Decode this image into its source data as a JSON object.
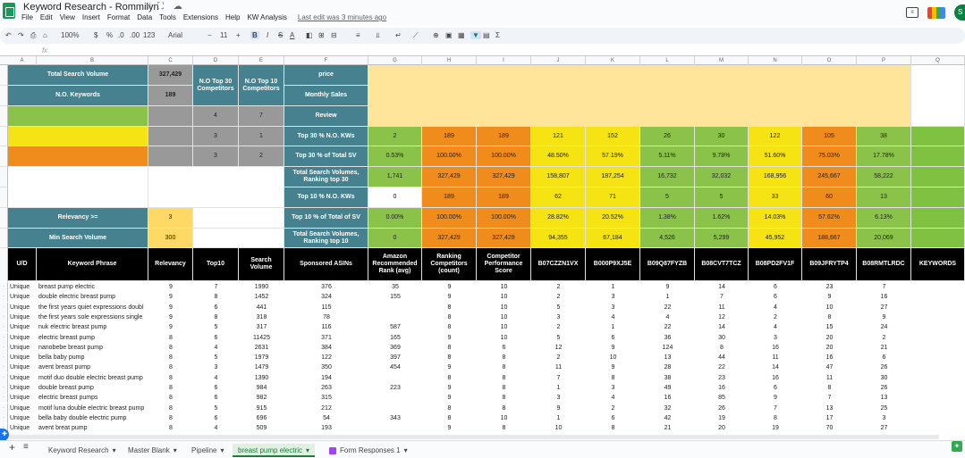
{
  "doc": {
    "title": "Keyword Research - Rommilyn",
    "star": "☆",
    "icons": "⛶ ☁",
    "last_edit": "Last edit was 3 minutes ago"
  },
  "menu": [
    "File",
    "Edit",
    "View",
    "Insert",
    "Format",
    "Data",
    "Tools",
    "Extensions",
    "Help",
    "KW Analysis"
  ],
  "toolbar": {
    "undo": "↶",
    "redo": "↷",
    "print": "⎙",
    "paint": "⌂",
    "zoom": "100%",
    "currency": "$",
    "percent": "%",
    "dec_down": ".0",
    "dec_up": ".00",
    "format": "123",
    "font": "Arial",
    "size": "11",
    "minus": "−",
    "plus": "+",
    "bold": "B",
    "italic": "I",
    "strike": "S",
    "textcolor": "A",
    "fill": "◧",
    "borders": "⊞",
    "merge": "⊟",
    "halign": "≡",
    "valign": "⫫",
    "wrap": "↵",
    "rotate": "⟋",
    "link": "⊕",
    "comment": "▣",
    "chart": "▦",
    "filter": "▼",
    "filterviews": "▤",
    "functions": "Σ"
  },
  "formula": {
    "fx": "fx"
  },
  "colors": {
    "teal": "#45818e",
    "gray": "#999999",
    "yellow": "#ffd966",
    "green": "#8bc34a",
    "bright_yellow": "#f5e313",
    "orange": "#f08c1c",
    "black": "#000000"
  },
  "cols": [
    "A",
    "B",
    "C",
    "D",
    "E",
    "F",
    "G",
    "H",
    "I",
    "J",
    "K",
    "L",
    "M",
    "N",
    "O",
    "P",
    "Q"
  ],
  "summary": {
    "tsv_label": "Total Search Volume",
    "tsv": "327,429",
    "nok_label": "N.O. Keywords",
    "nok": "189",
    "top30_comp": "N.O Top 30 Competitors",
    "top10_comp": "N.O Top 10 Competitors",
    "price": "price",
    "monthly": "Monthly Sales",
    "review": "Review",
    "r3d": "4",
    "r3e": "7",
    "r4d": "3",
    "r4e": "1",
    "r5d": "3",
    "r5e": "2",
    "relevancy_label": "Relevancy >=",
    "relevancy": "3",
    "minsv_label": "Min Search Volume",
    "minsv": "300"
  },
  "metrics": [
    {
      "label": "Top 30 % N.O. KWs",
      "values": [
        "2",
        "189",
        "189",
        "121",
        "152",
        "26",
        "30",
        "122",
        "105",
        "38"
      ]
    },
    {
      "label": "Top 30 % of Total SV",
      "values": [
        "0.53%",
        "100.00%",
        "100.00%",
        "48.50%",
        "57.19%",
        "5.11%",
        "9.78%",
        "51.60%",
        "75.03%",
        "17.78%"
      ]
    },
    {
      "label": "Total Search Volumes, Ranking top 30",
      "values": [
        "1,741",
        "327,429",
        "327,429",
        "158,807",
        "187,254",
        "16,732",
        "32,032",
        "168,956",
        "245,667",
        "58,222"
      ]
    },
    {
      "label": "Top 10 % N.O. KWs",
      "values": [
        "0",
        "189",
        "189",
        "62",
        "71",
        "5",
        "5",
        "33",
        "60",
        "13"
      ]
    },
    {
      "label": "Top 10 % of Total of SV",
      "values": [
        "0.00%",
        "100.00%",
        "100.00%",
        "28.82%",
        "20.52%",
        "1.38%",
        "1.62%",
        "14.03%",
        "57.62%",
        "6.13%"
      ]
    },
    {
      "label": "Total Search Volumes, Ranking top 10",
      "values": [
        "0",
        "327,429",
        "327,429",
        "94,355",
        "67,184",
        "4,526",
        "5,299",
        "45,952",
        "188,667",
        "20,069"
      ]
    }
  ],
  "headers": [
    "U/D",
    "Keyword Phrase",
    "Relevancy",
    "Top10",
    "Search Volume",
    "Sponsored ASINs",
    "Amazon Recommended Rank (avg)",
    "Ranking Competitors (count)",
    "Competitor Performance Score",
    "B07CZZN1VX",
    "B000P9XJ5E",
    "B09Q87FYZB",
    "B08CVT7TCZ",
    "B08PD2FV1F",
    "B09JFRYTP4",
    "B08RMTLRDC",
    "KEYWORDS"
  ],
  "rows": [
    [
      "Unique",
      "breast pump electric",
      "9",
      "7",
      "1990",
      "376",
      "35",
      "9",
      "10",
      "2",
      "1",
      "9",
      "14",
      "6",
      "23",
      "7"
    ],
    [
      "Unique",
      "double electric breast pump",
      "9",
      "8",
      "1452",
      "324",
      "155",
      "9",
      "10",
      "2",
      "3",
      "1",
      "7",
      "6",
      "9",
      "16"
    ],
    [
      "Unique",
      "the first years quiet expressions doubl",
      "9",
      "6",
      "441",
      "115",
      "",
      "8",
      "10",
      "5",
      "3",
      "22",
      "11",
      "4",
      "10",
      "27"
    ],
    [
      "Unique",
      "the first years sole expressions single",
      "9",
      "8",
      "318",
      "78",
      "",
      "8",
      "10",
      "3",
      "4",
      "4",
      "12",
      "2",
      "8",
      "9"
    ],
    [
      "Unique",
      "nuk electric breast pump",
      "9",
      "5",
      "317",
      "116",
      "587",
      "8",
      "10",
      "2",
      "1",
      "22",
      "14",
      "4",
      "15",
      "24"
    ],
    [
      "Unique",
      "electric breast pump",
      "8",
      "6",
      "11425",
      "371",
      "165",
      "9",
      "10",
      "5",
      "6",
      "36",
      "30",
      "3",
      "20",
      "2"
    ],
    [
      "Unique",
      "nanobebe breast pump",
      "8",
      "4",
      "2631",
      "384",
      "369",
      "8",
      "6",
      "12",
      "9",
      "124",
      "8",
      "16",
      "20",
      "21"
    ],
    [
      "Unique",
      "bella baby pump",
      "8",
      "5",
      "1979",
      "122",
      "397",
      "8",
      "8",
      "2",
      "10",
      "13",
      "44",
      "11",
      "16",
      "6"
    ],
    [
      "Unique",
      "avent breast pump",
      "8",
      "3",
      "1479",
      "350",
      "454",
      "9",
      "8",
      "11",
      "9",
      "28",
      "22",
      "14",
      "47",
      "26"
    ],
    [
      "Unique",
      "motif duo double electric breast pump",
      "8",
      "4",
      "1390",
      "194",
      "",
      "8",
      "8",
      "7",
      "8",
      "38",
      "23",
      "16",
      "11",
      "30"
    ],
    [
      "Unique",
      "double breast pump",
      "8",
      "6",
      "984",
      "263",
      "223",
      "9",
      "8",
      "1",
      "3",
      "49",
      "16",
      "6",
      "8",
      "26"
    ],
    [
      "Unique",
      "electric breast pumps",
      "8",
      "6",
      "982",
      "315",
      "",
      "9",
      "8",
      "3",
      "4",
      "16",
      "85",
      "9",
      "7",
      "13"
    ],
    [
      "Unique",
      "motif luna double electric breast pump",
      "8",
      "5",
      "915",
      "212",
      "",
      "8",
      "8",
      "9",
      "2",
      "32",
      "26",
      "7",
      "13",
      "25"
    ],
    [
      "Unique",
      "bella baby double electric pump",
      "8",
      "6",
      "696",
      "54",
      "343",
      "8",
      "10",
      "1",
      "6",
      "42",
      "19",
      "8",
      "17",
      "3"
    ],
    [
      "Unique",
      "avent breat pump",
      "8",
      "4",
      "509",
      "193",
      "",
      "9",
      "8",
      "10",
      "8",
      "21",
      "20",
      "19",
      "70",
      "27"
    ]
  ],
  "sheets": [
    {
      "name": "Keyword Research",
      "arrow": "▾"
    },
    {
      "name": "Master Blank",
      "arrow": "▾"
    },
    {
      "name": "Pipeline",
      "arrow": "▾"
    },
    {
      "name": "breast pump electric",
      "arrow": "▾"
    },
    {
      "name": "Form Responses 1",
      "arrow": "▾"
    }
  ],
  "bottom": {
    "add": "+",
    "list": "≡",
    "explore": "✦",
    "fab": "✚"
  }
}
